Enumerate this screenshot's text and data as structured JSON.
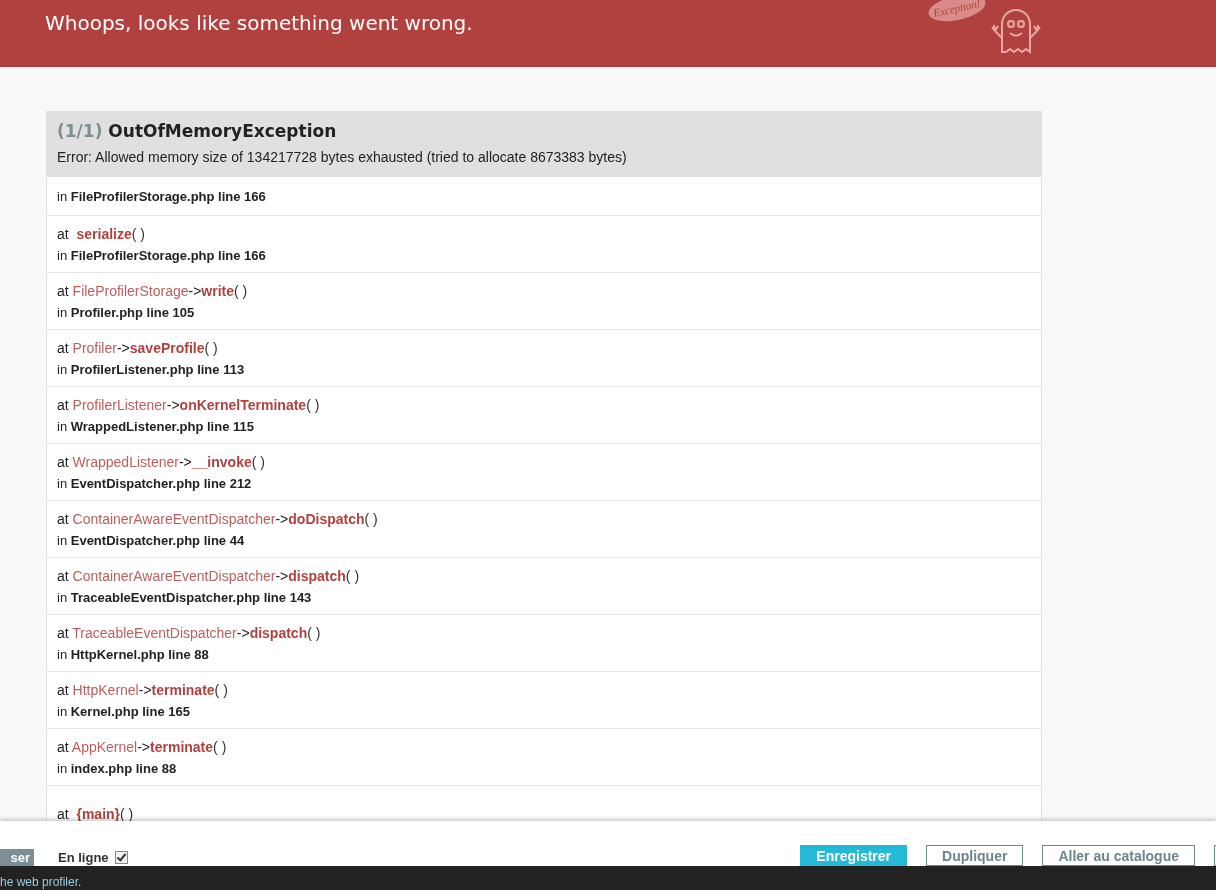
{
  "header": {
    "title": "Whoops, looks like something went wrong.",
    "logo_bubble": "Exception!"
  },
  "exception": {
    "count": "(1/1)",
    "name": "OutOfMemoryException",
    "message": "Error: Allowed memory size of 134217728 bytes exhausted (tried to allocate 8673383 bytes)"
  },
  "trace": [
    {
      "kind": "location",
      "location": "in **FileProfilerStorage.php line 166**"
    },
    {
      "kind": "function",
      "at": "at",
      "function": "serialize",
      "parens": "( )",
      "location": "in **FileProfilerStorage.php line 166**"
    },
    {
      "kind": "method",
      "at": "at",
      "class": "FileProfilerStorage",
      "arrow": "->",
      "function": "write",
      "parens": "( )",
      "location": "in **Profiler.php line 105**"
    },
    {
      "kind": "method",
      "at": "at",
      "class": "Profiler",
      "arrow": "->",
      "function": "saveProfile",
      "parens": "( )",
      "location": "in **ProfilerListener.php line 113**"
    },
    {
      "kind": "method",
      "at": "at",
      "class": "ProfilerListener",
      "arrow": "->",
      "function": "onKernelTerminate",
      "parens": "( )",
      "location": "in **WrappedListener.php line 115**"
    },
    {
      "kind": "method",
      "at": "at",
      "class": "WrappedListener",
      "arrow": "->",
      "function": "__invoke",
      "parens": "( )",
      "location": "in **EventDispatcher.php line 212**"
    },
    {
      "kind": "method",
      "at": "at",
      "class": "ContainerAwareEventDispatcher",
      "arrow": "->",
      "function": "doDispatch",
      "parens": "( )",
      "location": "in **EventDispatcher.php line 44**"
    },
    {
      "kind": "method",
      "at": "at",
      "class": "ContainerAwareEventDispatcher",
      "arrow": "->",
      "function": "dispatch",
      "parens": "( )",
      "location": "in **TraceableEventDispatcher.php line 143**"
    },
    {
      "kind": "method",
      "at": "at",
      "class": "TraceableEventDispatcher",
      "arrow": "->",
      "function": "dispatch",
      "parens": "( )",
      "location": "in **HttpKernel.php line 88**"
    },
    {
      "kind": "method",
      "at": "at",
      "class": "HttpKernel",
      "arrow": "->",
      "function": "terminate",
      "parens": "( )",
      "location": "in **Kernel.php line 165**"
    },
    {
      "kind": "method",
      "at": "at",
      "class": "AppKernel",
      "arrow": "->",
      "function": "terminate",
      "parens": "( )",
      "location": "in **index.php line 88**"
    },
    {
      "kind": "function",
      "at": "at",
      "function": "{main}",
      "parens": "( )"
    }
  ],
  "action_bar": {
    "left_button": "ser",
    "online": {
      "label": "En ligne",
      "checked": true
    },
    "buttons": [
      {
        "label": "Enregistrer",
        "kind": "primary"
      },
      {
        "label": "Dupliquer",
        "kind": "secondary"
      },
      {
        "label": "Aller au catalogue",
        "kind": "secondary"
      },
      {
        "kind": "secondary"
      }
    ]
  },
  "toolbar": {
    "text": "he web profiler."
  }
}
